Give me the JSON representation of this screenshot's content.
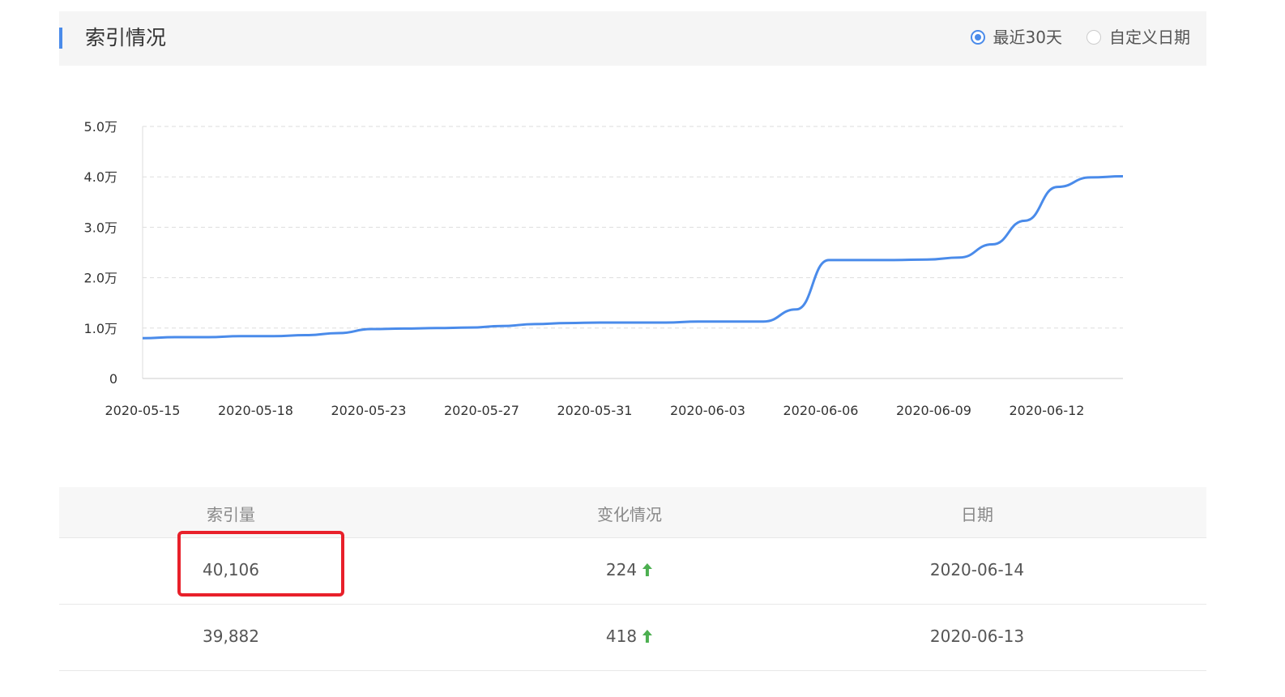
{
  "header": {
    "title": "索引情况",
    "accent_color": "#4a8bea",
    "range_options": [
      {
        "label": "最近30天",
        "selected": true
      },
      {
        "label": "自定义日期",
        "selected": false
      }
    ]
  },
  "chart_data": {
    "type": "line",
    "title": "",
    "xlabel": "",
    "ylabel": "",
    "ylim": [
      0,
      50000
    ],
    "yticks": [
      {
        "value": 0,
        "label": "0"
      },
      {
        "value": 10000,
        "label": "1.0万"
      },
      {
        "value": 20000,
        "label": "2.0万"
      },
      {
        "value": 30000,
        "label": "3.0万"
      },
      {
        "value": 40000,
        "label": "4.0万"
      },
      {
        "value": 50000,
        "label": "5.0万"
      }
    ],
    "xtick_labels": [
      "2020-05-15",
      "2020-05-18",
      "2020-05-23",
      "2020-05-27",
      "2020-05-31",
      "2020-06-03",
      "2020-06-06",
      "2020-06-09",
      "2020-06-12"
    ],
    "grid": true,
    "line_color": "#4a8bea",
    "series": [
      {
        "x": [
          "2020-05-15",
          "2020-05-16",
          "2020-05-17",
          "2020-05-18",
          "2020-05-19",
          "2020-05-20",
          "2020-05-21",
          "2020-05-22",
          "2020-05-23",
          "2020-05-24",
          "2020-05-25",
          "2020-05-26",
          "2020-05-27",
          "2020-05-28",
          "2020-05-29",
          "2020-05-30",
          "2020-05-31",
          "2020-06-01",
          "2020-06-02",
          "2020-06-03",
          "2020-06-04",
          "2020-06-05",
          "2020-06-06",
          "2020-06-07",
          "2020-06-08",
          "2020-06-09",
          "2020-06-10",
          "2020-06-11",
          "2020-06-12",
          "2020-06-13",
          "2020-06-14"
        ],
        "values": [
          8000,
          8200,
          8200,
          8400,
          8400,
          8600,
          9000,
          9800,
          9900,
          10000,
          10100,
          10400,
          10800,
          11000,
          11100,
          11100,
          11100,
          11300,
          11300,
          11300,
          13700,
          23500,
          23500,
          23500,
          23600,
          24000,
          26600,
          31300,
          38000,
          39882,
          40106
        ]
      }
    ]
  },
  "table": {
    "columns": [
      "索引量",
      "变化情况",
      "日期"
    ],
    "rows": [
      {
        "count": "40,106",
        "change": "224",
        "trend": "up-arrow-icon",
        "date": "2020-06-14"
      },
      {
        "count": "39,882",
        "change": "418",
        "trend": "up-arrow-icon",
        "date": "2020-06-13"
      }
    ],
    "up_color": "#4caf50",
    "highlight_color": "#e8202a"
  }
}
